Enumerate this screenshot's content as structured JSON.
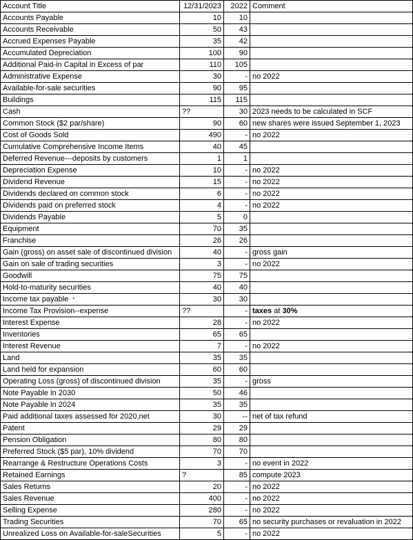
{
  "headers": {
    "c0": "Account Title",
    "c1": "12/31/2023",
    "c2": "2022",
    "c3": "Comment"
  },
  "rows": [
    {
      "title": "Accounts Payable",
      "v2023": "10",
      "v2022": "10",
      "comment": ""
    },
    {
      "title": "Accounts Receivable",
      "v2023": "50",
      "v2022": "43",
      "comment": ""
    },
    {
      "title": "Accrued Expenses Payable",
      "v2023": "35",
      "v2022": "42",
      "comment": ""
    },
    {
      "title": "Accumulated Depreciation",
      "v2023": "100",
      "v2022": "90",
      "comment": ""
    },
    {
      "title": "Additional Paid-in Capital in Excess of par",
      "v2023": "110",
      "v2022": "105",
      "comment": ""
    },
    {
      "title": "Administrative Expense",
      "v2023": "30",
      "v2022": "-",
      "comment": "no 2022"
    },
    {
      "title": "Available-for-sale securities",
      "v2023": "90",
      "v2022": "95",
      "comment": ""
    },
    {
      "title": "Buildings",
      "v2023": "115",
      "v2022": "115",
      "comment": ""
    },
    {
      "title": "Cash",
      "v2023": "??",
      "v2022": "30",
      "comment": "2023 needs to be calculated in SCF",
      "v2023_align": "left"
    },
    {
      "title": "Common Stock ($2 par/share)",
      "v2023": "90",
      "v2022": "60",
      "comment": "new shares were issued September 1, 2023"
    },
    {
      "title": "Cost of Goods Sold",
      "v2023": "490",
      "v2022": "-",
      "comment": "no 2022"
    },
    {
      "title": "Cumulative Comprehensive Income Items",
      "v2023": "40",
      "v2022": "45",
      "comment": ""
    },
    {
      "title": "Deferred Revenue---deposits by customers",
      "v2023": "1",
      "v2022": "1",
      "comment": ""
    },
    {
      "title": "Depreciation Expense",
      "v2023": "10",
      "v2022": "-",
      "comment": "no 2022"
    },
    {
      "title": "Dividend Revenue",
      "v2023": "15",
      "v2022": "-",
      "comment": "no 2022"
    },
    {
      "title": "Dividends declared on common stock",
      "v2023": "6",
      "v2022": "-",
      "comment": "no 2022"
    },
    {
      "title": "Dividends paid on preferred stock",
      "v2023": "4",
      "v2022": "-",
      "comment": "no 2022"
    },
    {
      "title": "Dividends Payable",
      "v2023": "5",
      "v2022": "0",
      "comment": ""
    },
    {
      "title": "Equipment",
      "v2023": "70",
      "v2022": "35",
      "comment": ""
    },
    {
      "title": "Franchise",
      "v2023": "26",
      "v2022": "26",
      "comment": ""
    },
    {
      "title": "Gain (gross) on asset sale of discontinued division",
      "v2023": "40",
      "v2022": "-",
      "comment": "gross gain"
    },
    {
      "title": "Gain on sale of trading securities",
      "v2023": "3",
      "v2022": "-",
      "comment": "no 2022"
    },
    {
      "title": "Goodwill",
      "v2023": "75",
      "v2022": "75",
      "comment": ""
    },
    {
      "title": "Hold-to-maturity securities",
      "v2023": "40",
      "v2022": "40",
      "comment": ""
    },
    {
      "title": "Income tax payable",
      "v2023": "30",
      "v2022": "30",
      "comment": "",
      "redmark": true
    },
    {
      "title": "Income Tax Provision--expense",
      "v2023": "??",
      "v2022": "-",
      "comment_html": "<b>taxes</b> at <b>30%</b>",
      "v2023_align": "left"
    },
    {
      "title": "Interest Expense",
      "v2023": "28",
      "v2022": "-",
      "comment": "no 2022"
    },
    {
      "title": "Inventories",
      "v2023": "65",
      "v2022": "65",
      "comment": ""
    },
    {
      "title": "Interest Revenue",
      "v2023": "7",
      "v2022": "-",
      "comment": "no 2022"
    },
    {
      "title": "Land",
      "v2023": "35",
      "v2022": "35",
      "comment": ""
    },
    {
      "title": "Land held for expansion",
      "v2023": "60",
      "v2022": "60",
      "comment": ""
    },
    {
      "title": "Operating Loss (gross) of discontinued division",
      "v2023": "35",
      "v2022": "-",
      "comment": "gross"
    },
    {
      "title": "Note Payable in 2030",
      "v2023": "50",
      "v2022": "46",
      "comment": ""
    },
    {
      "title": "Note Payable in 2024",
      "v2023": "35",
      "v2022": "35",
      "comment": ""
    },
    {
      "title": "Paid additional taxes assessed for 2020,net",
      "v2023": "30",
      "v2022": "--",
      "comment": "net of tax refund"
    },
    {
      "title": "Patent",
      "v2023": "29",
      "v2022": "29",
      "comment": ""
    },
    {
      "title": "Pension Obligation",
      "v2023": "80",
      "v2022": "80",
      "comment": ""
    },
    {
      "title": "Preferred Stock ($5 par), 10% dividend",
      "v2023": "70",
      "v2022": "70",
      "comment": ""
    },
    {
      "title": "Rearrange & Restructure Operations Costs",
      "v2023": "3",
      "v2022": "-",
      "comment": "no event in 2022"
    },
    {
      "title": "Retained Earnings",
      "v2023": "?",
      "v2022": "85",
      "comment": "compute 2023",
      "v2023_align": "left"
    },
    {
      "title": "Sales Returns",
      "v2023": "20",
      "v2022": "-",
      "comment": "no 2022"
    },
    {
      "title": "Sales Revenue",
      "v2023": "400",
      "v2022": "-",
      "comment": "no 2022"
    },
    {
      "title": "Selling Expense",
      "v2023": "280",
      "v2022": "-",
      "comment": "no 2022"
    },
    {
      "title": "Trading Securities",
      "v2023": "70",
      "v2022": "65",
      "comment": "no security purchases or revaluation in 2022"
    },
    {
      "title": "Unrealized Loss on Available-for-saleSecurities",
      "v2023": "5",
      "v2022": "-",
      "comment": "no 2022"
    }
  ]
}
